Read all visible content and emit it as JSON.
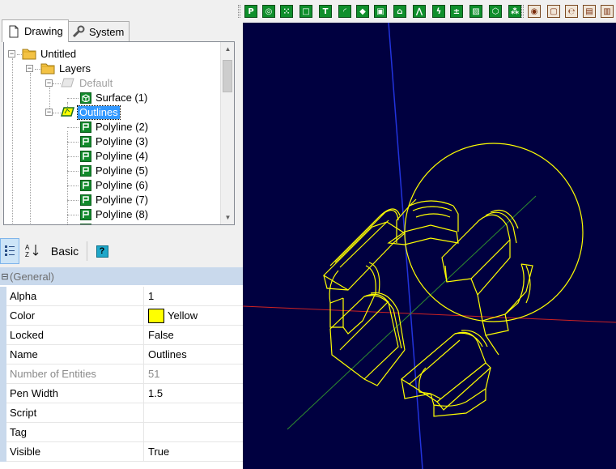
{
  "tabs": [
    {
      "label": "Drawing",
      "icon": "document-icon",
      "active": true
    },
    {
      "label": "System",
      "icon": "wrench-icon",
      "active": false
    }
  ],
  "tree": {
    "root": "Untitled",
    "layers": "Layers",
    "default_layer": "Default",
    "surface": "Surface (1)",
    "outlines": "Outlines",
    "polylines": [
      "Polyline (2)",
      "Polyline (3)",
      "Polyline (4)",
      "Polyline (5)",
      "Polyline (6)",
      "Polyline (7)",
      "Polyline (8)"
    ]
  },
  "property_toolbar": {
    "basic_label": "Basic",
    "help_label": "?"
  },
  "property_grid": {
    "category": "(General)",
    "rows": [
      {
        "name": "Alpha",
        "value": "1"
      },
      {
        "name": "Color",
        "value": "Yellow"
      },
      {
        "name": "Locked",
        "value": "False"
      },
      {
        "name": "Name",
        "value": "Outlines"
      },
      {
        "name": "Number of Entities",
        "value": "51"
      },
      {
        "name": "Pen Width",
        "value": "1.5"
      },
      {
        "name": "Script",
        "value": ""
      },
      {
        "name": "Tag",
        "value": ""
      },
      {
        "name": "Visible",
        "value": "True"
      }
    ]
  },
  "colors": {
    "viewport_bg": "#000040",
    "entity": "#ffff00",
    "x_axis": "#cc2222",
    "y_axis": "#2233dd",
    "z_axis": "#2e8b2e",
    "selection": "#3399ff",
    "tool_green": "#0f8f2c"
  }
}
